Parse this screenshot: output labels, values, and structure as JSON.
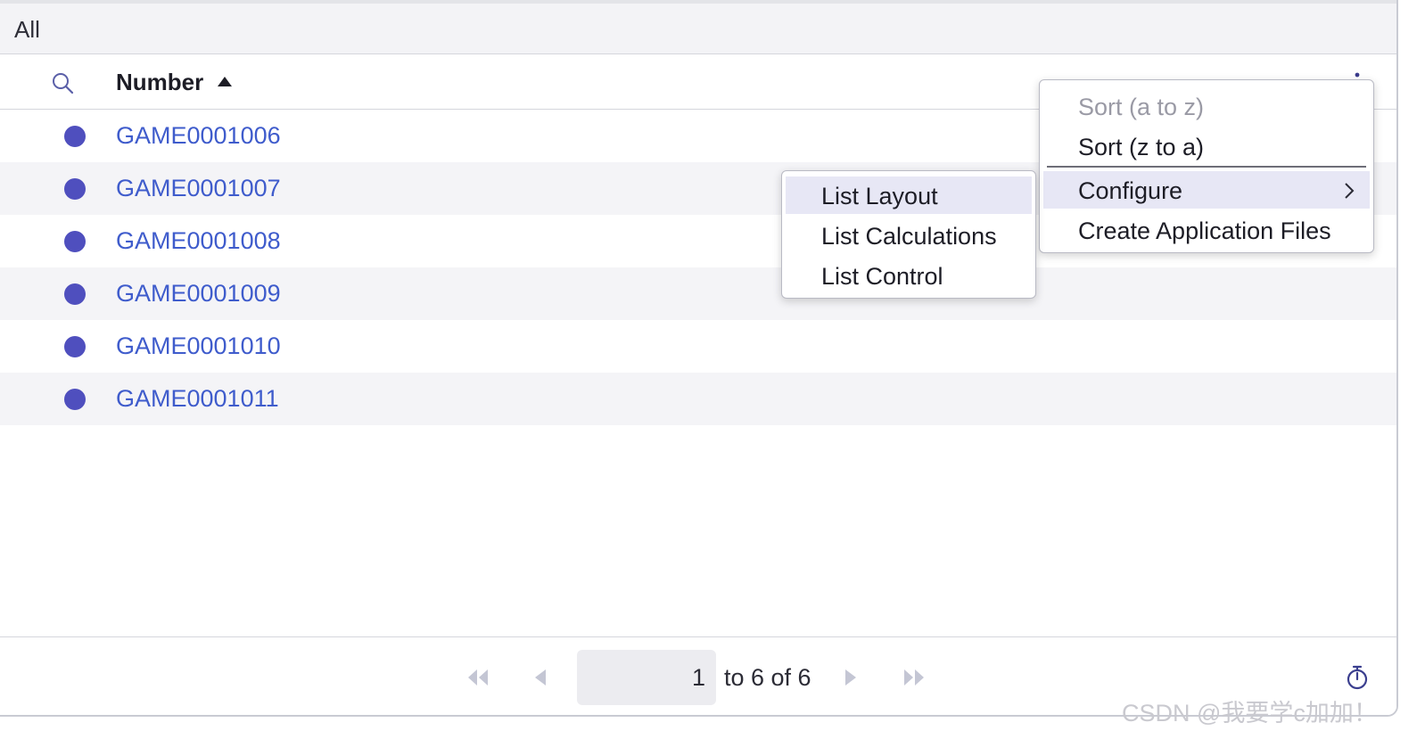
{
  "filter": {
    "label": "All"
  },
  "header": {
    "column_title": "Number",
    "search_icon": "search-icon",
    "sort_icon": "sort-ascending-icon",
    "more_icon": "vertical-dots-icon"
  },
  "rows": [
    {
      "number": "GAME0001006"
    },
    {
      "number": "GAME0001007"
    },
    {
      "number": "GAME0001008"
    },
    {
      "number": "GAME0001009"
    },
    {
      "number": "GAME0001010"
    },
    {
      "number": "GAME0001011"
    }
  ],
  "context_menu": {
    "items": [
      {
        "label": "Sort (a to z)",
        "disabled": true
      },
      {
        "label": "Sort (z to a)"
      },
      {
        "label": "Configure",
        "has_submenu": true,
        "highlighted": true
      },
      {
        "label": "Create Application Files"
      }
    ]
  },
  "submenu": {
    "items": [
      {
        "label": "List Layout",
        "highlighted": true
      },
      {
        "label": "List Calculations"
      },
      {
        "label": "List Control"
      }
    ]
  },
  "pagination": {
    "current_page": "1",
    "range_text": "to 6 of 6"
  },
  "watermark": "CSDN @我要学c加加！",
  "colors": {
    "accent": "#4f4fbe",
    "link": "#3f5ccc",
    "row_alt": "#f4f4f7",
    "menu_highlight": "#e7e7f5"
  }
}
